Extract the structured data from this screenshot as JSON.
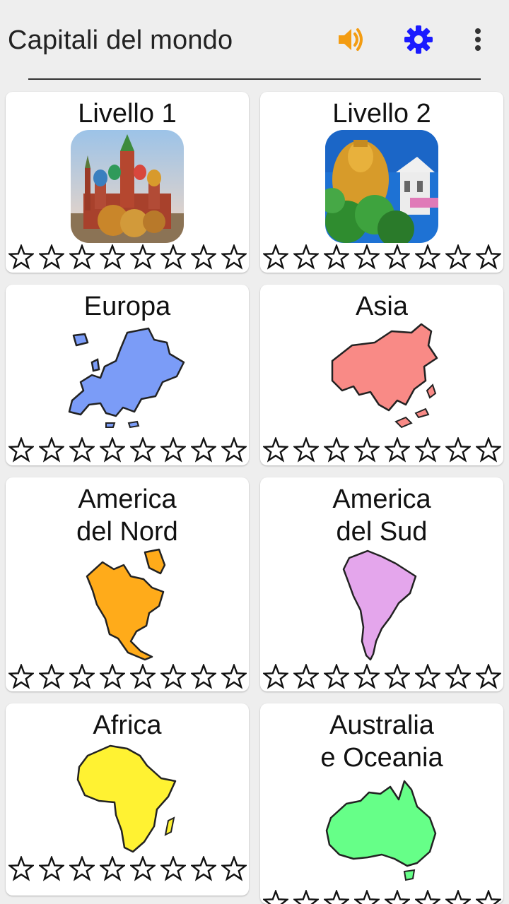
{
  "app": {
    "title": "Capitali del mondo",
    "icons": {
      "sound": "volume-up-icon",
      "settings": "gear-icon",
      "menu": "more-vert-icon"
    },
    "colors": {
      "sound": "#f39c12",
      "settings": "#1a1aff"
    }
  },
  "levels": [
    {
      "id": "livello-1",
      "title_lines": [
        "Livello 1"
      ],
      "image": "moscow-cathedral-photo",
      "stars_filled": 0,
      "stars_total": 8
    },
    {
      "id": "livello-2",
      "title_lines": [
        "Livello 2"
      ],
      "image": "golden-buddha-temple-photo",
      "stars_filled": 0,
      "stars_total": 8
    },
    {
      "id": "europa",
      "title_lines": [
        "Europa"
      ],
      "image": "europe-map",
      "color": "#7b9cf7",
      "stars_filled": 0,
      "stars_total": 8
    },
    {
      "id": "asia",
      "title_lines": [
        "Asia"
      ],
      "image": "asia-map",
      "color": "#f98a86",
      "stars_filled": 0,
      "stars_total": 8
    },
    {
      "id": "america-nord",
      "title_lines": [
        "America",
        "del Nord"
      ],
      "image": "north-america-map",
      "color": "#ffab1a",
      "stars_filled": 0,
      "stars_total": 8
    },
    {
      "id": "america-sud",
      "title_lines": [
        "America",
        "del Sud"
      ],
      "image": "south-america-map",
      "color": "#e4a6ec",
      "stars_filled": 0,
      "stars_total": 8
    },
    {
      "id": "africa",
      "title_lines": [
        "Africa"
      ],
      "image": "africa-map",
      "color": "#fff232",
      "stars_filled": 0,
      "stars_total": 8
    },
    {
      "id": "australia",
      "title_lines": [
        "Australia",
        "e Oceania"
      ],
      "image": "australia-map",
      "color": "#66ff88",
      "stars_filled": 0,
      "stars_total": 8
    }
  ]
}
